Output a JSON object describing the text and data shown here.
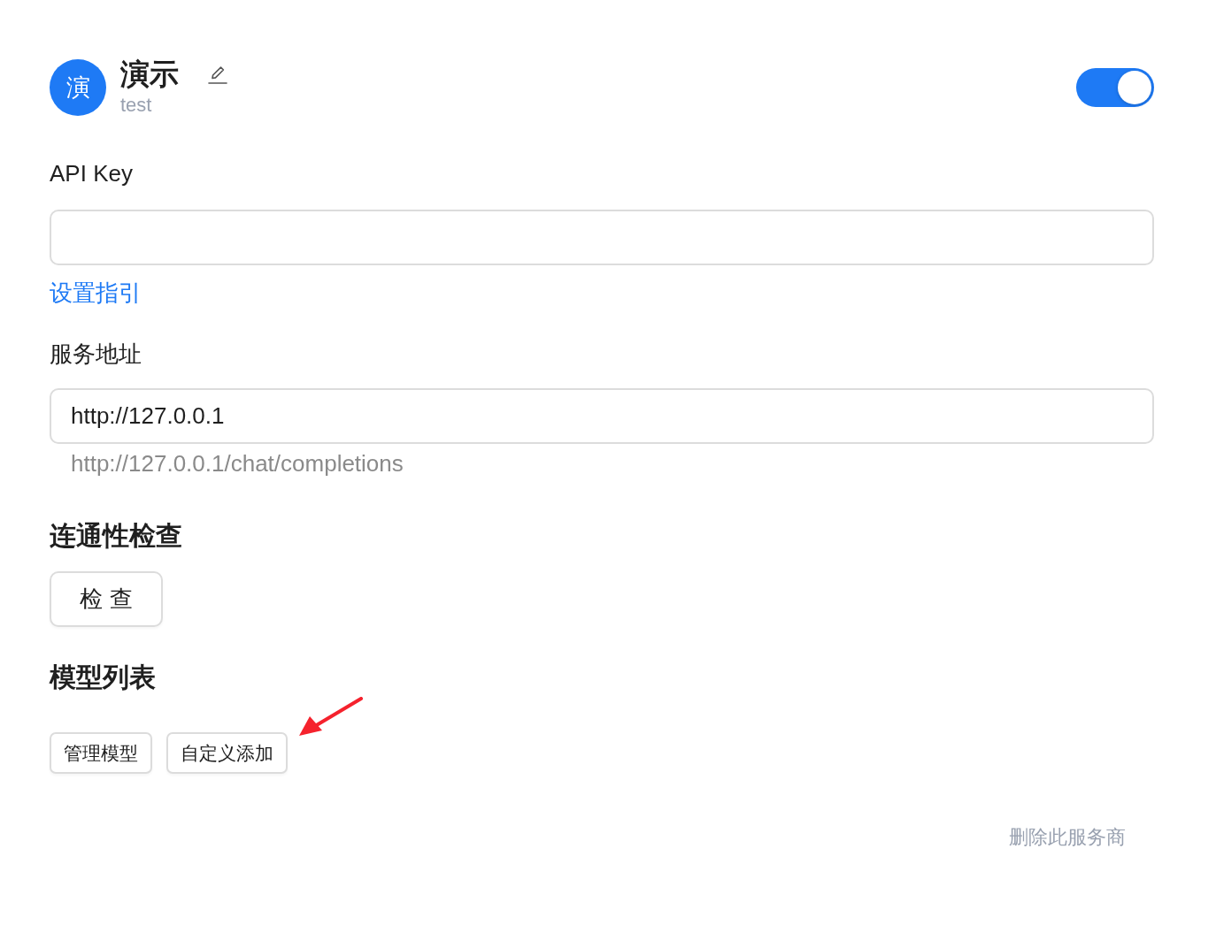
{
  "provider": {
    "avatar_text": "演",
    "name": "演示",
    "subtitle": "test",
    "enabled": true
  },
  "api_key": {
    "label": "API Key"
  },
  "guide_link": "设置指引",
  "service_address": {
    "label": "服务地址",
    "value": "http://127.0.0.1",
    "preview": "http://127.0.0.1/chat/completions"
  },
  "connectivity": {
    "heading": "连通性检查",
    "button": "检 查"
  },
  "models": {
    "heading": "模型列表",
    "buttons": [
      "管理模型",
      "自定义添加"
    ]
  },
  "annotation": {
    "kind": "arrow"
  },
  "delete_link": "删除此服务商"
}
